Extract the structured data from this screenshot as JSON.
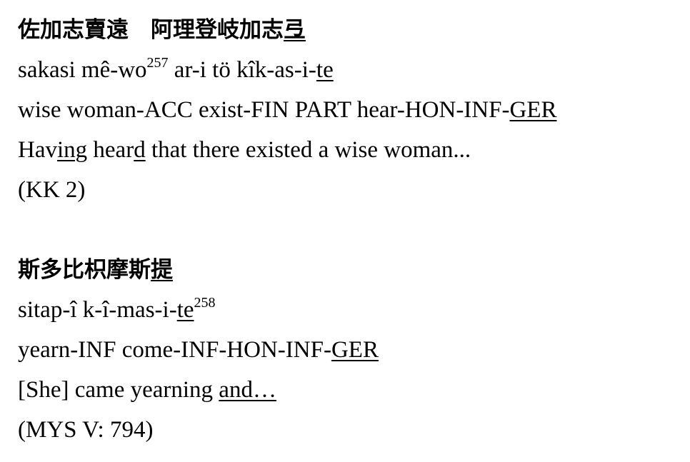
{
  "example1": {
    "kanji_a": "佐加志賣遠",
    "kanji_b": "阿理登岐加志",
    "kanji_u": "弖",
    "translit_a": "sakasi mê-wo",
    "translit_sup": "257",
    "translit_b": " ar-i tö kîk-as-i-",
    "translit_u": "te",
    "gloss_a": "wise woman-ACC exist-FIN PART hear-HON-INF-",
    "gloss_u": "GER",
    "trans_1": "Hav",
    "trans_2": "ing",
    "trans_3": " hear",
    "trans_4": "d",
    "trans_5": " that there existed a wise woman...",
    "source": "(KK 2)"
  },
  "example2": {
    "kanji_a": "斯多比枳摩斯",
    "kanji_u": "提",
    "translit_a": "sitap-î k-î-mas-i-",
    "translit_u": "te",
    "translit_sup": "258",
    "gloss_a": "yearn-INF come-INF-HON-INF-",
    "gloss_u": "GER",
    "trans_a": "[She] came yearning ",
    "trans_u": "and…",
    "source": "(MYS V: 794)"
  }
}
